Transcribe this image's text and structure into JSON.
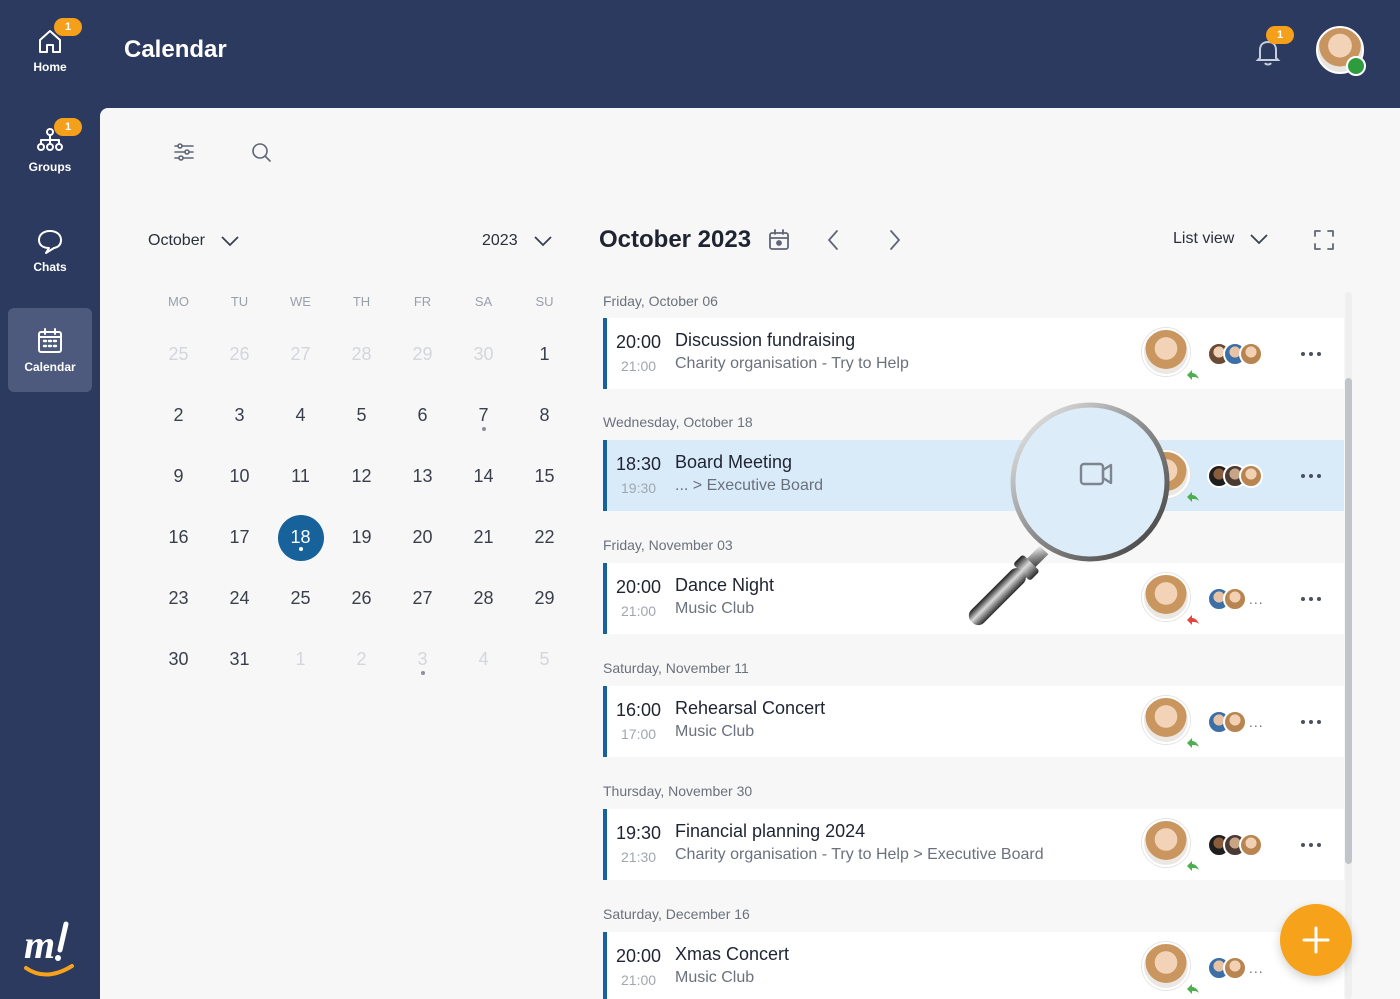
{
  "header": {
    "title": "Calendar",
    "notification_count": "1"
  },
  "nav": [
    {
      "label": "Home",
      "badge": "1",
      "icon": "home-icon"
    },
    {
      "label": "Groups",
      "badge": "1",
      "icon": "groups-icon"
    },
    {
      "label": "Chats",
      "badge": "",
      "icon": "chat-icon"
    },
    {
      "label": "Calendar",
      "badge": "",
      "icon": "calendar-icon"
    }
  ],
  "mini_calendar": {
    "month": "October",
    "year": "2023",
    "weekdays": [
      "MO",
      "TU",
      "WE",
      "TH",
      "FR",
      "SA",
      "SU"
    ],
    "today": "18",
    "days": [
      "25",
      "26",
      "27",
      "28",
      "29",
      "30",
      "1",
      "2",
      "3",
      "4",
      "5",
      "6",
      "7",
      "8",
      "9",
      "10",
      "11",
      "12",
      "13",
      "14",
      "15",
      "16",
      "17",
      "18",
      "19",
      "20",
      "21",
      "22",
      "23",
      "24",
      "25",
      "26",
      "27",
      "28",
      "29",
      "30",
      "31",
      "1",
      "2",
      "3",
      "4",
      "5"
    ]
  },
  "list": {
    "title": "October 2023",
    "view": "List view"
  },
  "events": [
    {
      "date": "Friday, October 06",
      "start": "20:00",
      "end": "21:00",
      "title": "Discussion fundraising",
      "sub": "Charity organisation - Try to Help",
      "more": ""
    },
    {
      "date": "Wednesday, October 18",
      "start": "18:30",
      "end": "19:30",
      "title": "Board Meeting",
      "sub": "... > Executive Board",
      "more": ""
    },
    {
      "date": "Friday, November 03",
      "start": "20:00",
      "end": "21:00",
      "title": "Dance Night",
      "sub": "Music Club",
      "more": "..."
    },
    {
      "date": "Saturday, November 11",
      "start": "16:00",
      "end": "17:00",
      "title": "Rehearsal Concert",
      "sub": "Music Club",
      "more": "..."
    },
    {
      "date": "Thursday, November 30",
      "start": "19:30",
      "end": "21:30",
      "title": "Financial planning 2024",
      "sub": "Charity organisation - Try to Help > Executive Board",
      "more": ""
    },
    {
      "date": "Saturday, December 16",
      "start": "20:00",
      "end": "21:00",
      "title": "Xmas Concert",
      "sub": "Music Club",
      "more": "..."
    }
  ],
  "colors": {
    "nav_bg": "#2b3a5e",
    "accent": "#17629a",
    "badge": "#f5a01a",
    "fab": "#f7a21b",
    "selected_row": "#d9ebf8"
  }
}
